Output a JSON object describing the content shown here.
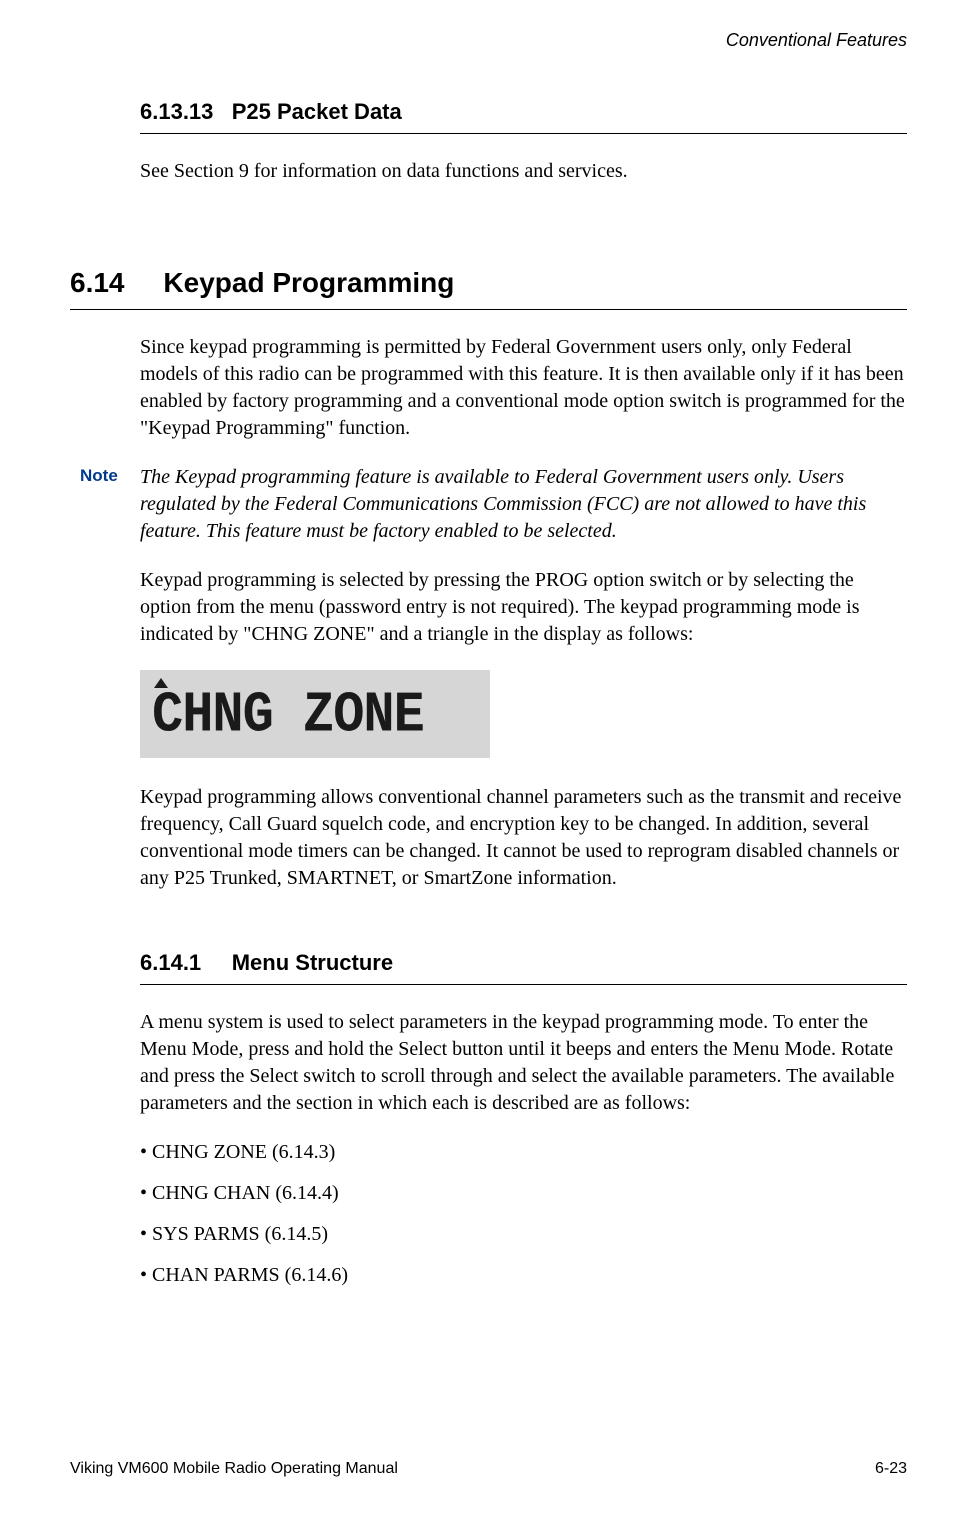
{
  "header": {
    "running_title": "Conventional Features"
  },
  "sections": {
    "s1": {
      "number": "6.13.13",
      "title": "P25 Packet Data",
      "body": "See Section 9 for information on data functions and services."
    },
    "s2": {
      "number": "6.14",
      "title": "Keypad Programming",
      "p1": "Since keypad programming is permitted by Federal Government users only, only Federal models of this radio can be programmed with this feature. It is then available only if it has been enabled by factory programming and a conventional mode option switch is programmed for the \"Keypad Programming\" function.",
      "note_label": "Note",
      "note_text": "The Keypad programming feature is available to Federal Government users only. Users regulated by the Federal Communications Commission (FCC) are not allowed to have this feature. This feature must be factory enabled to be selected.",
      "p2": "Keypad programming is selected by pressing the PROG option switch or by selecting the option from the menu (password entry is not required). The keypad programming mode is indicated by \"CHNG ZONE\" and a triangle in the display as follows:",
      "lcd_text": "CHNG ZONE",
      "p3": "Keypad programming allows conventional channel parameters such as the transmit and receive frequency, Call Guard squelch code, and encryption key to be changed. In addition, several conventional mode timers can be changed. It cannot be used to reprogram disabled channels or any P25 Trunked, SMARTNET, or SmartZone information."
    },
    "s3": {
      "number": "6.14.1",
      "title": "Menu Structure",
      "p1": "A menu system is used to select parameters in the keypad programming mode. To enter the Menu Mode, press and hold the Select button until it beeps and enters the Menu Mode. Rotate and press the Select switch to scroll through and select the available parameters. The available parameters and the section in which each is described are as follows:",
      "bullets": {
        "b0": "CHNG ZONE (6.14.3)",
        "b1": "CHNG CHAN (6.14.4)",
        "b2": "SYS PARMS (6.14.5)",
        "b3": "CHAN PARMS (6.14.6)"
      }
    }
  },
  "footer": {
    "left": "Viking VM600 Mobile Radio Operating Manual",
    "right": "6-23"
  }
}
